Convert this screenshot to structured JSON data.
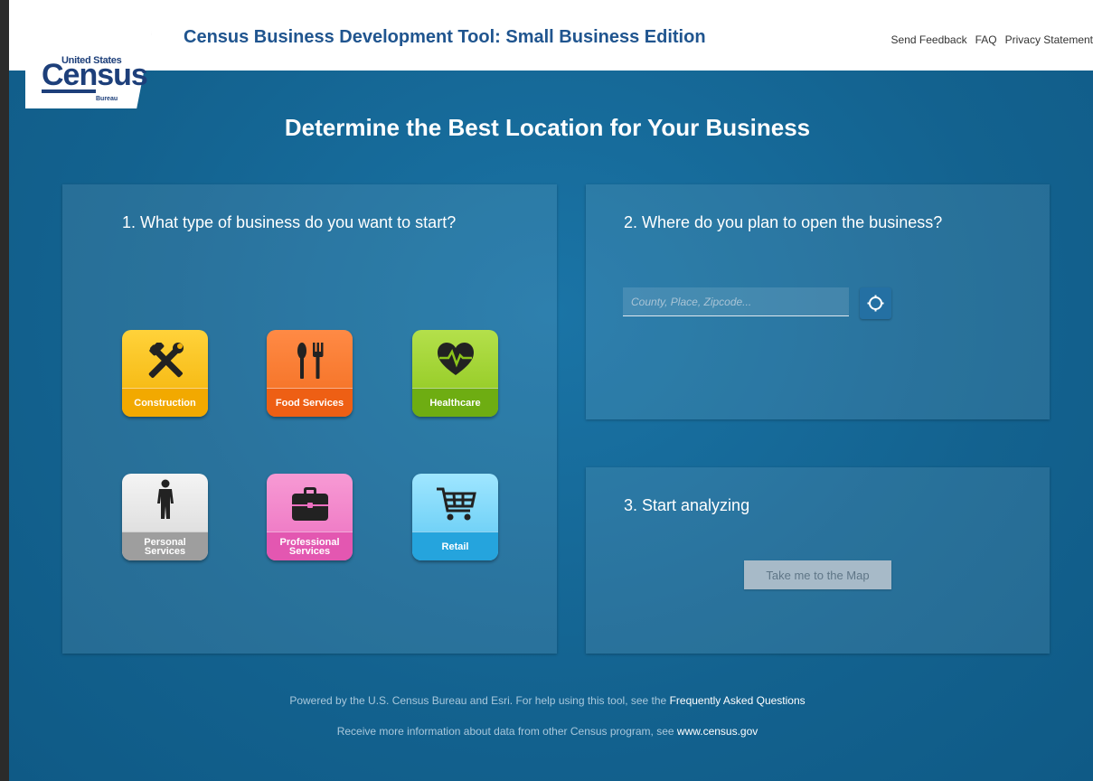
{
  "header": {
    "logo_top": "United States",
    "logo_main": "Census",
    "logo_sub": "Bureau",
    "title": "Census Business Development Tool: Small Business Edition",
    "links": [
      "Send Feedback",
      "FAQ",
      "Privacy Statement"
    ]
  },
  "headline": "Determine the Best Location for Your Business",
  "step1": {
    "title": "1. What type of business do you want to start?",
    "businesses": [
      {
        "label": "Construction",
        "icon": "tools-icon"
      },
      {
        "label": "Food Services",
        "icon": "fork-knife-icon"
      },
      {
        "label": "Healthcare",
        "icon": "heart-pulse-icon"
      },
      {
        "label": "Personal Services",
        "icon": "person-icon"
      },
      {
        "label": "Professional Services",
        "icon": "briefcase-icon"
      },
      {
        "label": "Retail",
        "icon": "shopping-cart-icon"
      }
    ]
  },
  "step2": {
    "title": "2. Where do you plan to open the business?",
    "search_placeholder": "County, Place, Zipcode...",
    "search_value": "",
    "locate_icon": "locate-icon"
  },
  "step3": {
    "title": "3. Start analyzing",
    "button_label": "Take me to the Map"
  },
  "footer": {
    "line1_text": "Powered by the U.S. Census Bureau and Esri. For help using this tool, see the ",
    "line1_link": "Frequently Asked Questions",
    "line2_text": "Receive more information about data from other Census program, see ",
    "line2_link": "www.census.gov"
  }
}
